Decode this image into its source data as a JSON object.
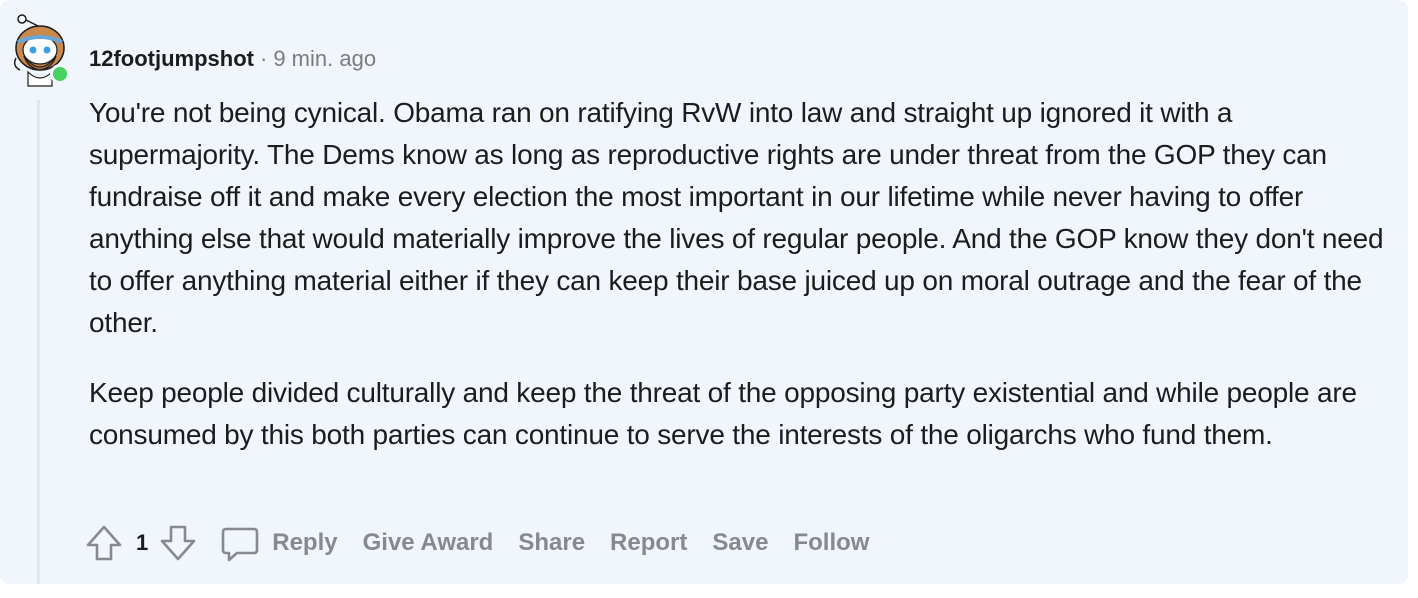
{
  "comment": {
    "author": "12footjumpshot",
    "separator": "·",
    "time": "9 min. ago",
    "paragraphs": [
      "You're not being cynical. Obama ran on ratifying RvW into law and straight up ignored it with a supermajority. The Dems know as long as reproductive rights are under threat from the GOP they can fundraise off it and make every election the most important in our lifetime while never having to offer anything else that would materially improve the lives of regular people. And the GOP know they don't need to offer anything material either if they can keep their base juiced up on moral outrage and the fear of the other.",
      "Keep people divided culturally and keep the threat of the opposing party existential and while people are consumed by this both parties can continue to serve the interests of the oligarchs who fund them."
    ],
    "vote_count": "1",
    "actions": {
      "reply": "Reply",
      "give_award": "Give Award",
      "share": "Share",
      "report": "Report",
      "save": "Save",
      "follow": "Follow"
    }
  },
  "icons": {
    "avatar": "snoo-avatar-icon",
    "upvote": "upvote-arrow-icon",
    "downvote": "downvote-arrow-icon",
    "reply": "comment-bubble-icon"
  },
  "colors": {
    "card_background": "#f1f5fc",
    "text": "#1c1c1c",
    "muted": "#878a8c",
    "online": "#46d160"
  }
}
